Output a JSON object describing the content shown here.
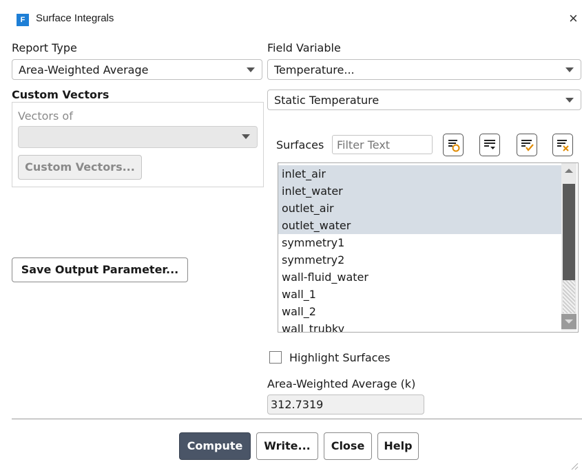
{
  "window": {
    "title": "Surface Integrals",
    "app_icon_letter": "F",
    "close_symbol": "×"
  },
  "report_type": {
    "label": "Report Type",
    "value": "Area-Weighted Average"
  },
  "field_variable": {
    "label": "Field Variable",
    "category": "Temperature...",
    "variable": "Static Temperature"
  },
  "custom_vectors": {
    "heading": "Custom Vectors",
    "vectors_of_label": "Vectors of",
    "vectors_of_value": "",
    "button": "Custom Vectors..."
  },
  "save_output_button": "Save Output Parameter...",
  "surfaces": {
    "label": "Surfaces",
    "filter_placeholder": "Filter Text",
    "items": [
      {
        "name": "inlet_air",
        "selected": true
      },
      {
        "name": "inlet_water",
        "selected": true
      },
      {
        "name": "outlet_air",
        "selected": true
      },
      {
        "name": "outlet_water",
        "selected": true
      },
      {
        "name": "symmetry1",
        "selected": false
      },
      {
        "name": "symmetry2",
        "selected": false
      },
      {
        "name": "wall-fluid_water",
        "selected": false
      },
      {
        "name": "wall_1",
        "selected": false
      },
      {
        "name": "wall_2",
        "selected": false
      },
      {
        "name": "wall_trubky",
        "selected": false
      }
    ]
  },
  "highlight_surfaces": {
    "label": "Highlight Surfaces",
    "checked": false
  },
  "result": {
    "label": "Area-Weighted Average (k)",
    "value": "312.7319"
  },
  "buttons": {
    "compute": "Compute",
    "write": "Write...",
    "close": "Close",
    "help": "Help"
  },
  "colors": {
    "selection": "#d6dde5",
    "primary_button": "#4a5567",
    "icon_accent": "#e08a00"
  }
}
